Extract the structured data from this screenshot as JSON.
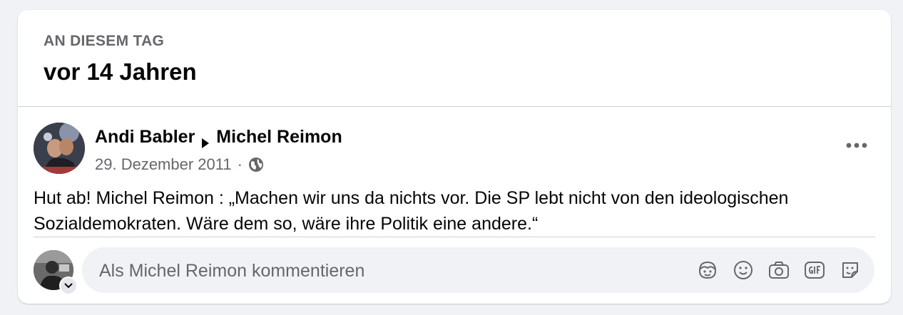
{
  "section": {
    "label": "AN DIESEM TAG",
    "title": "vor 14 Jahren"
  },
  "post": {
    "author": "Andi Babler",
    "recipient": "Michel Reimon",
    "date": "29. Dezember 2011",
    "separator": "·",
    "audience_icon": "globe-icon",
    "text": "Hut ab! Michel Reimon : „Machen wir uns da nichts vor. Die SP lebt nicht von den ideologischen Sozialdemokraten. Wäre dem so, wäre ihre Politik eine andere.“"
  },
  "comment": {
    "placeholder": "Als Michel Reimon kommentieren",
    "icons": [
      "avatar-sticker-icon",
      "emoji-icon",
      "camera-icon",
      "gif-icon",
      "sticker-icon"
    ]
  }
}
